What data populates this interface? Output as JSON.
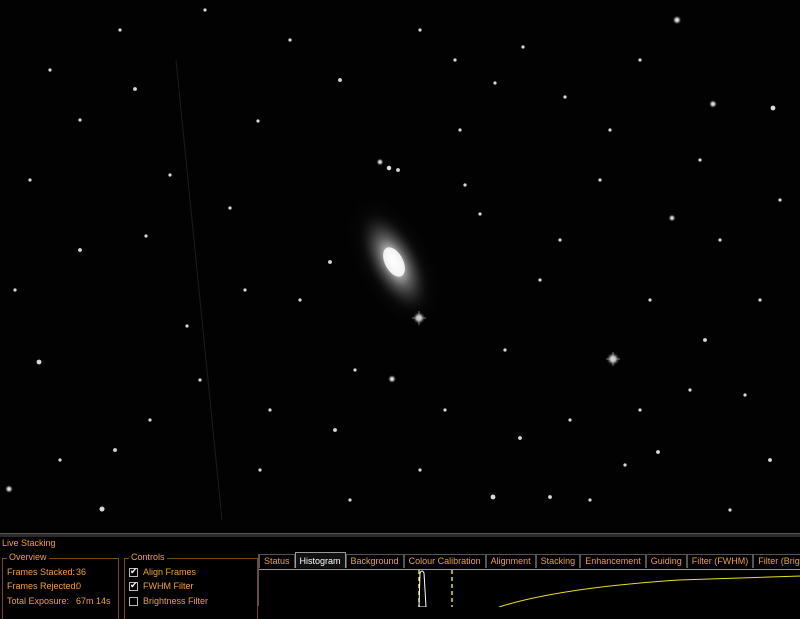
{
  "window": {
    "title": "Live Stacking"
  },
  "overview": {
    "legend": "Overview",
    "stats": [
      {
        "label": "Frames Stacked:",
        "value": "36"
      },
      {
        "label": "Frames Rejected:",
        "value": "0"
      },
      {
        "label": "Total Exposure:",
        "value": "67m 14s"
      }
    ]
  },
  "controls": {
    "legend": "Controls",
    "items": [
      {
        "label": "Align Frames",
        "checked": true
      },
      {
        "label": "FWHM Filter",
        "checked": true
      },
      {
        "label": "Brightness Filter",
        "checked": false
      }
    ]
  },
  "tabs": [
    {
      "label": "Status",
      "active": false
    },
    {
      "label": "Histogram",
      "active": true
    },
    {
      "label": "Background",
      "active": false
    },
    {
      "label": "Colour Calibration",
      "active": false
    },
    {
      "label": "Alignment",
      "active": false
    },
    {
      "label": "Stacking",
      "active": false
    },
    {
      "label": "Enhancement",
      "active": false
    },
    {
      "label": "Guiding",
      "active": false
    },
    {
      "label": "Filter (FWHM)",
      "active": false
    },
    {
      "label": "Filter (Brightness",
      "active": false
    }
  ],
  "colors": {
    "accent": "#f0a030",
    "histogram_marker": "#e8e020",
    "background": "#000000"
  }
}
